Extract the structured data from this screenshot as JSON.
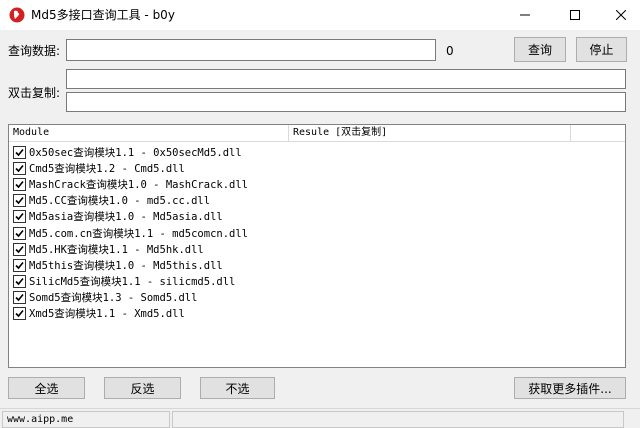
{
  "window": {
    "title": "Md5多接口查询工具 - b0y"
  },
  "query": {
    "label": "查询数据:",
    "value": "",
    "count": "0",
    "query_button": "查询",
    "stop_button": "停止"
  },
  "copy": {
    "label": "双击复制:",
    "line1": "",
    "line2": ""
  },
  "list": {
    "columns": [
      "Module",
      "Resule [双击复制]"
    ],
    "rows": [
      {
        "checked": true,
        "text": "0x50sec查询模块1.1 - 0x50secMd5.dll"
      },
      {
        "checked": true,
        "text": "Cmd5查询模块1.2 - Cmd5.dll"
      },
      {
        "checked": true,
        "text": "MashCrack查询模块1.0 - MashCrack.dll"
      },
      {
        "checked": true,
        "text": "Md5.CC查询模块1.0 - md5.cc.dll"
      },
      {
        "checked": true,
        "text": "Md5asia查询模块1.0 - Md5asia.dll"
      },
      {
        "checked": true,
        "text": "Md5.com.cn查询模块1.1 - md5comcn.dll"
      },
      {
        "checked": true,
        "text": "Md5.HK查询模块1.1 - Md5hk.dll"
      },
      {
        "checked": true,
        "text": "Md5this查询模块1.0 - Md5this.dll"
      },
      {
        "checked": true,
        "text": "SilicMd5查询模块1.1 - silicmd5.dll"
      },
      {
        "checked": true,
        "text": "Somd5查询模块1.3 - Somd5.dll"
      },
      {
        "checked": true,
        "text": "Xmd5查询模块1.1 - Xmd5.dll"
      }
    ]
  },
  "buttons": {
    "select_all": "全选",
    "invert": "反选",
    "select_none": "不选",
    "more_plugins": "获取更多插件..."
  },
  "status": {
    "left": "www.aipp.me",
    "right": ""
  },
  "icons": {
    "app": "app-logo-icon",
    "minimize": "minimize-icon",
    "maximize": "maximize-icon",
    "close": "close-icon",
    "checkbox": "check-icon"
  },
  "colors": {
    "window_bg": "#f0f0f0",
    "title_bg": "#ffffff",
    "accent_logo": "#d32020"
  }
}
